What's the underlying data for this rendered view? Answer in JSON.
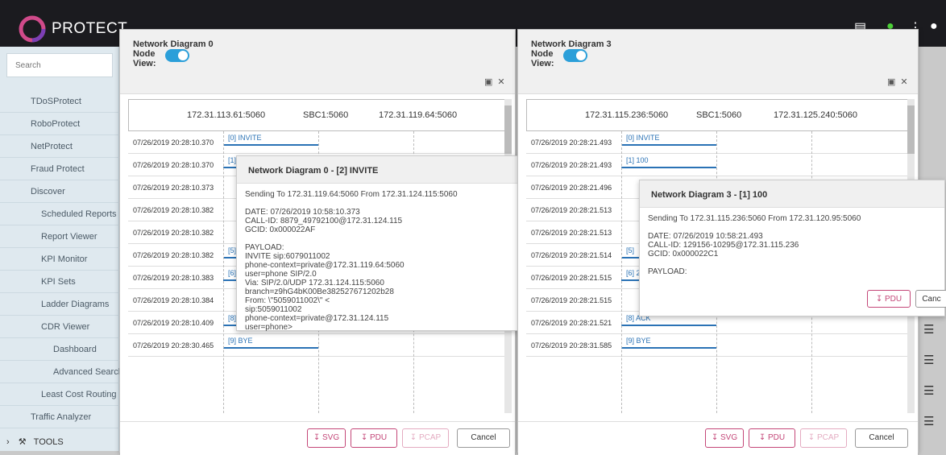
{
  "app": {
    "brand": "PROTECT"
  },
  "sidebar": {
    "search_placeholder": "Search",
    "items": [
      {
        "label": "TDoSProtect"
      },
      {
        "label": "RoboProtect"
      },
      {
        "label": "NetProtect"
      },
      {
        "label": "Fraud Protect"
      },
      {
        "label": "Discover"
      },
      {
        "label": "Scheduled Reports"
      },
      {
        "label": "Report Viewer"
      },
      {
        "label": "KPI Monitor"
      },
      {
        "label": "KPI Sets"
      },
      {
        "label": "Ladder Diagrams"
      },
      {
        "label": "CDR Viewer"
      },
      {
        "label": "Dashboard"
      },
      {
        "label": "Advanced Search"
      },
      {
        "label": "Least Cost Routing"
      },
      {
        "label": "Traffic Analyzer"
      }
    ],
    "tools_label": "TOOLS"
  },
  "panels": [
    {
      "title": "Network Diagram 0",
      "node_label": "Node",
      "view_label": "View:",
      "hosts": [
        "172.31.113.61:5060",
        "SBC1:5060",
        "172.31.119.64:5060"
      ],
      "rows": [
        {
          "time": "07/26/2019 20:28:10.370",
          "msg": "[0] INVITE"
        },
        {
          "time": "07/26/2019 20:28:10.370",
          "msg": "[1]"
        },
        {
          "time": "07/26/2019 20:28:10.373",
          "msg": ""
        },
        {
          "time": "07/26/2019 20:28:10.382",
          "msg": ""
        },
        {
          "time": "07/26/2019 20:28:10.382",
          "msg": ""
        },
        {
          "time": "07/26/2019 20:28:10.382",
          "msg": "[5]"
        },
        {
          "time": "07/26/2019 20:28:10.383",
          "msg": "[6]"
        },
        {
          "time": "07/26/2019 20:28:10.384",
          "msg": "[7] ACK"
        },
        {
          "time": "07/26/2019 20:28:10.409",
          "msg": "[8] ACK"
        },
        {
          "time": "07/26/2019 20:28:30.465",
          "msg": "[9] BYE"
        }
      ],
      "buttons": {
        "svg": "SVG",
        "pdu": "PDU",
        "pcap": "PCAP",
        "cancel": "Cancel"
      },
      "popup": {
        "title": "Network Diagram 0 - [2] INVITE",
        "lines": [
          "Sending To 172.31.119.64:5060 From 172.31.124.115:5060",
          "",
          "DATE: 07/26/2019 10:58:10.373",
          "CALL-ID: 8879_49792100@172.31.124.115",
          "GCID: 0x000022AF",
          "",
          "PAYLOAD:",
          "INVITE sip:6079011002",
          "phone-context=private@172.31.119.64:5060",
          "user=phone SIP/2.0",
          "Via: SIP/2.0/UDP 172.31.124.115:5060",
          "branch=z9hG4bK00Be382527671202b28",
          "From: \\\"5059011002\\\" <",
          "sip:5059011002",
          "phone-context=private@172.31.124.115",
          "user=phone>"
        ]
      }
    },
    {
      "title": "Network Diagram 3",
      "node_label": "Node",
      "view_label": "View:",
      "hosts": [
        "172.31.115.236:5060",
        "SBC1:5060",
        "172.31.125.240:5060"
      ],
      "rows": [
        {
          "time": "07/26/2019 20:28:21.493",
          "msg": "[0] INVITE"
        },
        {
          "time": "07/26/2019 20:28:21.493",
          "msg": "[1] 100"
        },
        {
          "time": "07/26/2019 20:28:21.496",
          "msg": ""
        },
        {
          "time": "07/26/2019 20:28:21.513",
          "msg": ""
        },
        {
          "time": "07/26/2019 20:28:21.513",
          "msg": ""
        },
        {
          "time": "07/26/2019 20:28:21.514",
          "msg": "[5]"
        },
        {
          "time": "07/26/2019 20:28:21.515",
          "msg": "[6] 200"
        },
        {
          "time": "07/26/2019 20:28:21.515",
          "msg": "[7] ACK"
        },
        {
          "time": "07/26/2019 20:28:21.521",
          "msg": "[8] ACK"
        },
        {
          "time": "07/26/2019 20:28:31.585",
          "msg": "[9] BYE"
        }
      ],
      "buttons": {
        "svg": "SVG",
        "pdu": "PDU",
        "pcap": "PCAP",
        "cancel": "Cancel"
      },
      "popup": {
        "title": "Network Diagram 3 - [1] 100",
        "lines": [
          "Sending To 172.31.115.236:5060 From 172.31.120.95:5060",
          "",
          "DATE: 07/26/2019 10:58:21.493",
          "CALL-ID: 129156-10295@172.31.115.236",
          "GCID: 0x000022C1",
          "",
          "PAYLOAD:"
        ],
        "pdu": "PDU",
        "cancel": "Canc"
      }
    }
  ],
  "colors": {
    "accent": "#c44778",
    "toggle": "#2b9fd9",
    "arrow": "#2a72b5"
  }
}
